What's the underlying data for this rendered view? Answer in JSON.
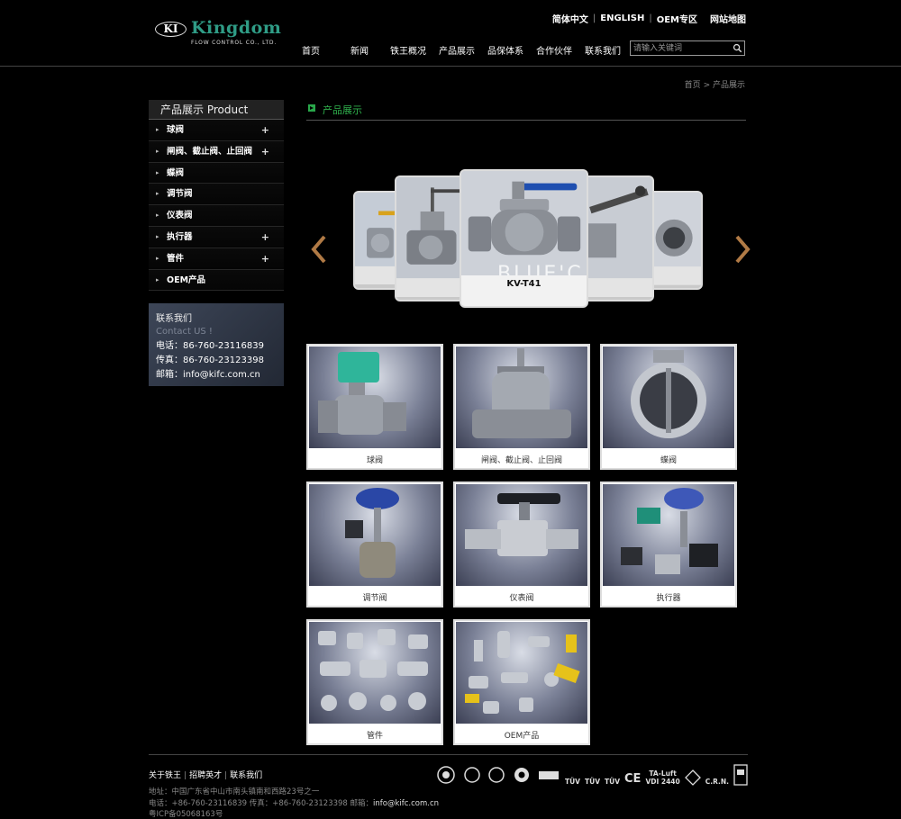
{
  "brand": {
    "badge": "KI",
    "name": "Kingdom",
    "subtitle": "FLOW CONTROL CO., LTD."
  },
  "top_nav": {
    "chinese": "简体中文",
    "english": "ENGLISH",
    "oem": "OEM专区",
    "sitemap": "网站地图"
  },
  "main_nav": [
    "首页",
    "新闻",
    "铁王概况",
    "产品展示",
    "品保体系",
    "合作伙伴",
    "联系我们"
  ],
  "search": {
    "placeholder": "请输入关键词"
  },
  "breadcrumb": {
    "home": "首页",
    "sep": ">",
    "current": "产品展示"
  },
  "sidebar": {
    "title": "产品展示 Product",
    "items": [
      {
        "label": "球阀",
        "plus": "+"
      },
      {
        "label": "闸阀、截止阀、止回阀",
        "plus": "+"
      },
      {
        "label": "蝶阀",
        "plus": ""
      },
      {
        "label": "调节阀",
        "plus": ""
      },
      {
        "label": "仪表阀",
        "plus": ""
      },
      {
        "label": "执行器",
        "plus": "+"
      },
      {
        "label": "管件",
        "plus": "+"
      },
      {
        "label": "OEM产品",
        "plus": ""
      }
    ]
  },
  "contact": {
    "title": "联系我们",
    "subtitle": "Contact US !",
    "phone": "电话：86-760-23116839",
    "fax": "传真：86-760-23123398",
    "email": "邮箱：info@kifc.com.cn"
  },
  "content": {
    "title": "产品展示",
    "carousel_caption": "KV-T41",
    "watermark": "BLUE'C"
  },
  "products": [
    "球阀",
    "闸阀、截止阀、止回阀",
    "蝶阀",
    "调节阀",
    "仪表阀",
    "执行器",
    "管件",
    "OEM产品"
  ],
  "footer": {
    "links": [
      "关于铁王",
      "招聘英才",
      "联系我们"
    ],
    "address": "地址：中国广东省中山市南头镇南和西路23号之一",
    "phone_fax": "电话：+86-760-23116839  传真：+86-760-23123398  邮箱：",
    "email": "info@kifc.com.cn",
    "icp": "粤ICP备05068163号",
    "certs": [
      "TÜV",
      "TÜV",
      "TÜV",
      "CE",
      "TA-Luft",
      "C.R.N."
    ],
    "cert_sub": [
      "",
      "",
      "",
      "",
      "VDI 2440",
      ""
    ]
  },
  "colors": {
    "accent": "#2fb04c",
    "brand": "#2f9c86",
    "arrow": "#b07a45"
  }
}
